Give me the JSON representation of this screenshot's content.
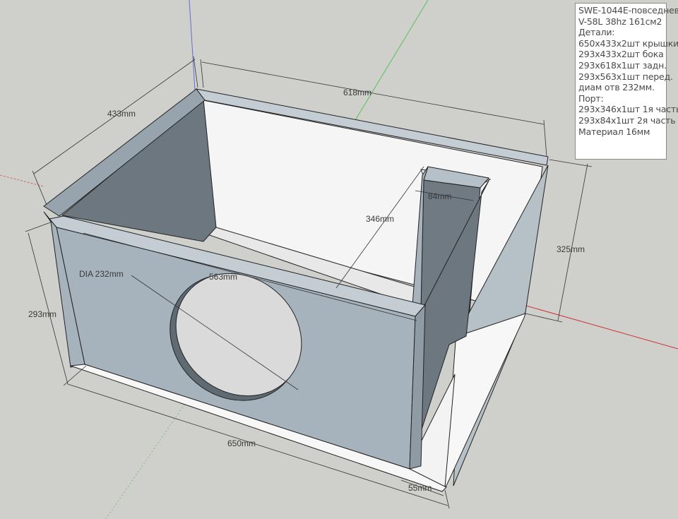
{
  "notes": {
    "lines": [
      "SWE-1044E-повседнев",
      "V-58L 38hz 161см2",
      "Детали:",
      "650x433x2шт крышки",
      "293x433x2шт бока",
      "293x618x1шт задн.",
      "293x563x1шт перед.",
      "диам отв 232мм.",
      "Порт:",
      "293x346x1шт 1я часть",
      "293x84x1шт 2я часть",
      "Материал 16мм"
    ]
  },
  "dimensions": {
    "top_depth": "433mm",
    "top_width": "618mm",
    "height_right": "325mm",
    "port_length": "346mm",
    "port_part2": "84mm",
    "hole_diameter": "DIA 232mm",
    "front_inner_width": "563mm",
    "height_left": "293mm",
    "bottom_width": "650mm",
    "port_gap": "55mm"
  },
  "colors": {
    "background": "#cfd0cc",
    "panel_blue": "#a7b3bc",
    "panel_dark": "#6c7780",
    "panel_white": "#f7f7f7",
    "dimension_line": "#333333"
  }
}
